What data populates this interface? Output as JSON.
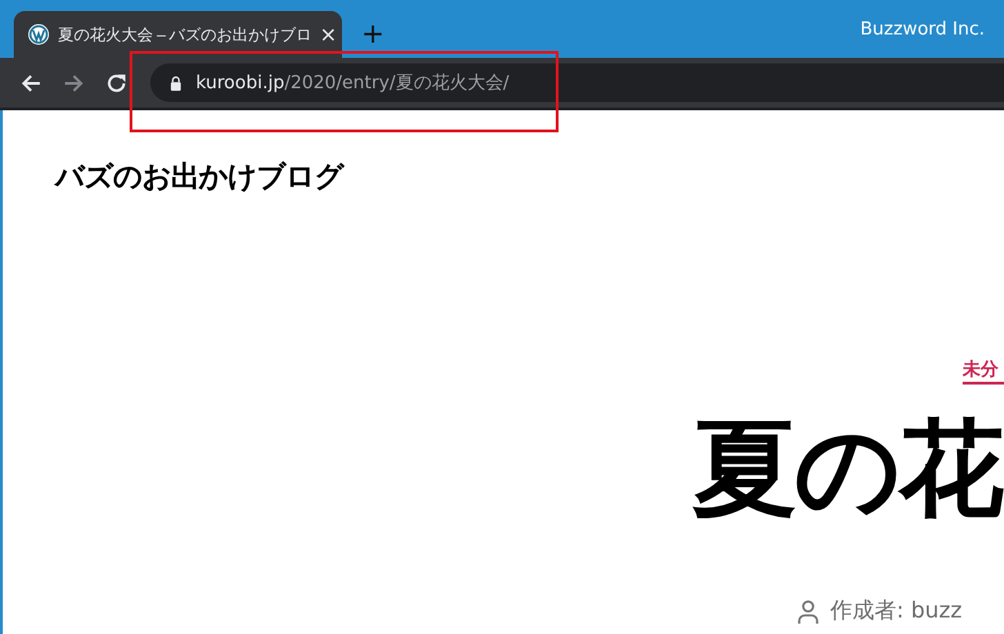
{
  "window": {
    "title": "Buzzword Inc."
  },
  "tabs": [
    {
      "title": "夏の花火大会 – バズのお出かけブロ",
      "selected": true,
      "close": "×"
    }
  ],
  "new_tab": "+",
  "address_bar": {
    "host": "kuroobi.jp",
    "path": "/2020/entry/夏の花火大会/"
  },
  "site_title": "バズのお出かけブログ",
  "post": {
    "category": "未分",
    "heading": "夏の花",
    "author": "作成者: buzz"
  }
}
